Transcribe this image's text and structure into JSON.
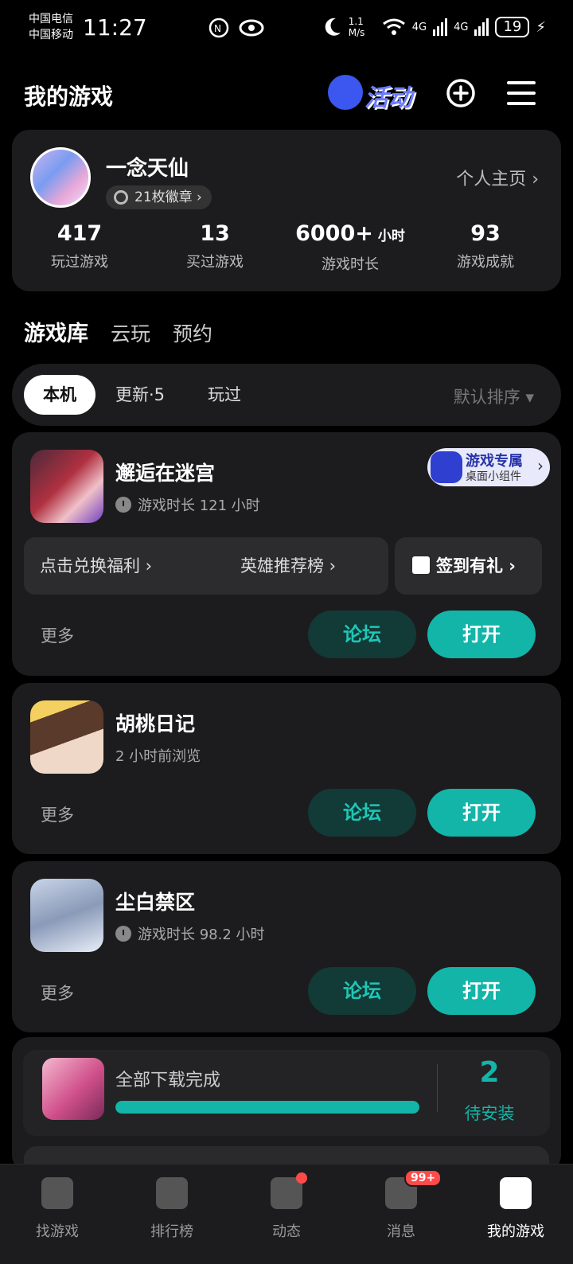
{
  "status_bar": {
    "carrier1": "中国电信",
    "carrier2": "中国移动",
    "time": "11:27",
    "speed": "1.1 M/s",
    "net1": "4G",
    "net2": "4G",
    "battery": "19"
  },
  "header": {
    "title": "我的游戏",
    "activity_label": "活动"
  },
  "profile": {
    "username": "一念天仙",
    "badges": "21枚徽章 ›",
    "home_link": "个人主页 ›",
    "stats": [
      {
        "num": "417",
        "unit": "",
        "label": "玩过游戏"
      },
      {
        "num": "13",
        "unit": "",
        "label": "买过游戏"
      },
      {
        "num": "6000+",
        "unit": "小时",
        "label": "游戏时长"
      },
      {
        "num": "93",
        "unit": "",
        "label": "游戏成就"
      }
    ]
  },
  "library_tabs": [
    "游戏库",
    "云玩",
    "预约"
  ],
  "filter": {
    "chips": [
      "本机",
      "更新·5",
      "玩过"
    ],
    "sort": "默认排序 ▾"
  },
  "widget": {
    "line1": "游戏专属",
    "line2": "桌面小组件"
  },
  "games": [
    {
      "name": "邂逅在迷宫",
      "meta": "游戏时长 121 小时"
    },
    {
      "name": "胡桃日记",
      "meta": "2 小时前浏览"
    },
    {
      "name": "尘白禁区",
      "meta": "游戏时长 98.2 小时"
    }
  ],
  "game1_actions": {
    "benefit1": "点击兑换福利 ›",
    "benefit2": "英雄推荐榜 ›",
    "signin": "签到有礼 ›"
  },
  "card_buttons": {
    "more": "更多",
    "forum": "论坛",
    "open": "打开"
  },
  "download": {
    "text": "全部下载完成",
    "progress": 1.0,
    "count": "2",
    "count_label": "待安装"
  },
  "bottom_nav": [
    {
      "label": "找游戏"
    },
    {
      "label": "排行榜"
    },
    {
      "label": "动态"
    },
    {
      "label": "消息",
      "badge": "99+"
    },
    {
      "label": "我的游戏"
    }
  ],
  "colors": {
    "accent": "#13b5a8",
    "card": "#1c1c1e",
    "badge_red": "#ff4a4a"
  }
}
